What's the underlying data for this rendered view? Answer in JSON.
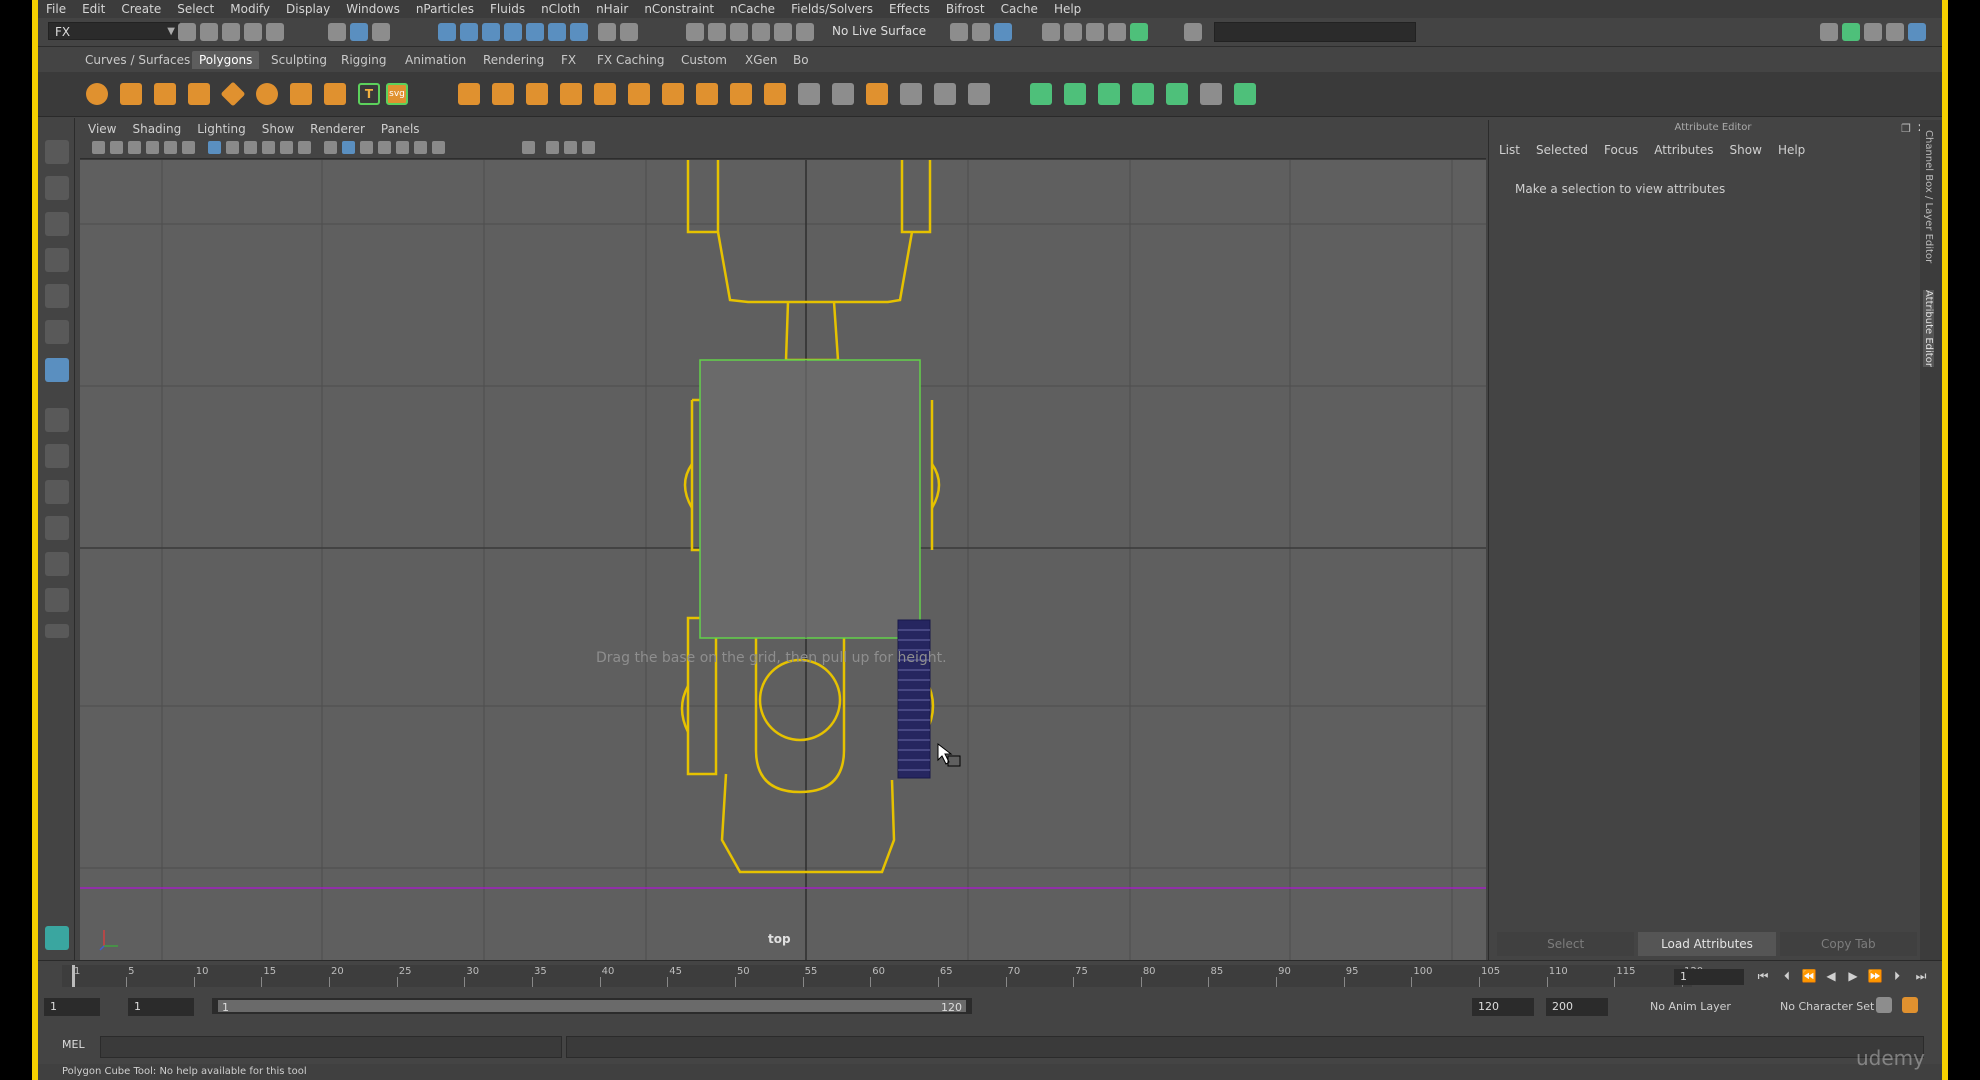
{
  "menu": [
    "File",
    "Edit",
    "Create",
    "Select",
    "Modify",
    "Display",
    "Windows",
    "nParticles",
    "Fluids",
    "nCloth",
    "nHair",
    "nConstraint",
    "nCache",
    "Fields/Solvers",
    "Effects",
    "Bifrost",
    "Cache",
    "Help"
  ],
  "status_line": {
    "mode": "FX",
    "live_surface": "No Live Surface"
  },
  "shelf_tabs": [
    "Curves / Surfaces",
    "Polygons",
    "Sculpting",
    "Rigging",
    "Animation",
    "Rendering",
    "FX",
    "FX Caching",
    "Custom",
    "XGen",
    "Bo"
  ],
  "active_shelf": "Polygons",
  "viewport": {
    "menu": [
      "View",
      "Shading",
      "Lighting",
      "Show",
      "Renderer",
      "Panels"
    ],
    "camera": "top",
    "hint": "Drag the base on the grid, then pull up for height."
  },
  "attribute_editor": {
    "title": "Attribute Editor",
    "menu": [
      "List",
      "Selected",
      "Focus",
      "Attributes",
      "Show",
      "Help"
    ],
    "message": "Make a selection to view attributes",
    "buttons": [
      "Select",
      "Load Attributes",
      "Copy Tab"
    ],
    "side_tabs": [
      "Channel Box / Layer Editor",
      "Attribute Editor"
    ]
  },
  "timeline": {
    "ticks": [
      "1",
      "5",
      "10",
      "15",
      "20",
      "25",
      "30",
      "35",
      "40",
      "45",
      "50",
      "55",
      "60",
      "65",
      "70",
      "75",
      "80",
      "85",
      "90",
      "95",
      "100",
      "105",
      "110",
      "115",
      "120"
    ],
    "current_frame": "1"
  },
  "range": {
    "start": "1",
    "playback_start": "1",
    "slider_start": "1",
    "slider_end": "120",
    "playback_end": "120",
    "end": "200",
    "anim_layer": "No Anim Layer",
    "character_set": "No Character Set"
  },
  "command_line": {
    "label": "MEL"
  },
  "help_line": "Polygon Cube Tool: No help available for this tool",
  "watermark": "udemy",
  "colors": {
    "frame": "#f5d000",
    "wireframe": "#e6c200",
    "highlight": "#63d14a",
    "accent": "#5a8fc0"
  }
}
